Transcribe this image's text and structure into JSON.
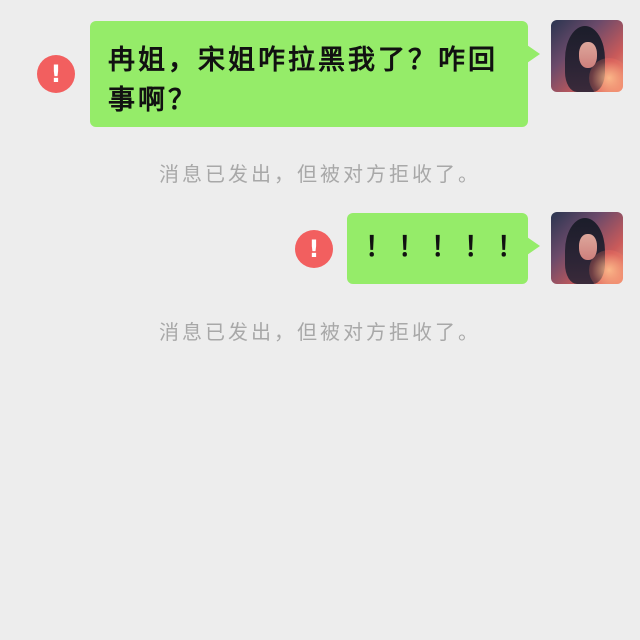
{
  "conversation": {
    "messages": [
      {
        "text": "冉姐，宋姐咋拉黑我了？咋回事啊？",
        "status_icon": "exclamation-mark",
        "status_icon_glyph": "!",
        "status_color": "#f25f5f",
        "notice": "消息已发出，但被对方拒收了。"
      },
      {
        "text": "！！！！！",
        "status_icon": "exclamation-mark",
        "status_icon_glyph": "!",
        "status_color": "#f25f5f",
        "notice": "消息已发出，但被对方拒收了。"
      }
    ]
  },
  "colors": {
    "background": "#ededed",
    "bubble": "#95ec69",
    "error": "#f25f5f",
    "notice_text": "#a8a8a8"
  }
}
